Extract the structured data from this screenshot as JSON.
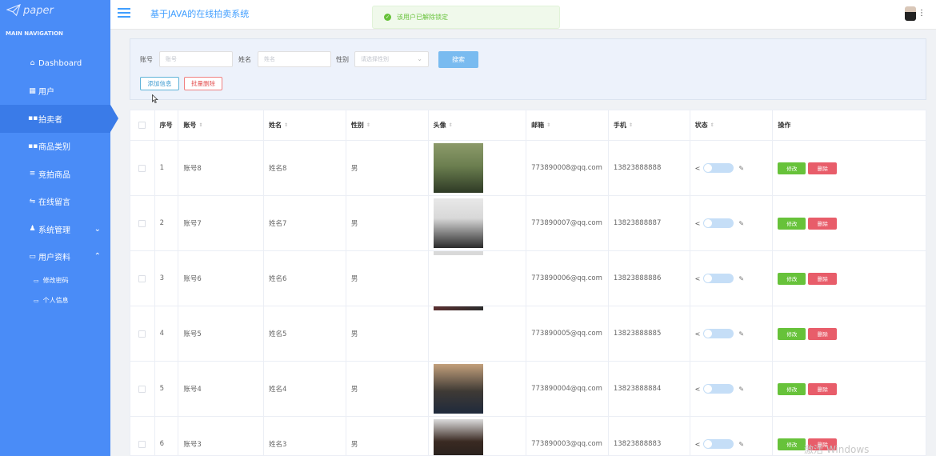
{
  "logo": {
    "text": "paper"
  },
  "sidebar": {
    "header": "MAIN NAVIGATION",
    "items": [
      {
        "label": "Dashboard",
        "icon": "home-icon",
        "glyph": "⌂"
      },
      {
        "label": "用户",
        "icon": "grid-icon",
        "glyph": "▦"
      },
      {
        "label": "拍卖者",
        "icon": "grid-icon",
        "glyph": "▪▪"
      },
      {
        "label": "商品类别",
        "icon": "grid-icon",
        "glyph": "▪▪"
      },
      {
        "label": "竞拍商品",
        "icon": "list-icon",
        "glyph": "≡"
      },
      {
        "label": "在线留言",
        "icon": "sliders-icon",
        "glyph": "⇋"
      },
      {
        "label": "系统管理",
        "icon": "user-icon",
        "glyph": "♟"
      },
      {
        "label": "用户资料",
        "icon": "card-icon",
        "glyph": "▭"
      }
    ],
    "subitems": [
      {
        "label": "修改密码",
        "icon": "folder-icon"
      },
      {
        "label": "个人信息",
        "icon": "folder-icon"
      }
    ]
  },
  "topbar": {
    "title": "基于JAVA的在线拍卖系统",
    "toast": "该用户已解除锁定"
  },
  "search": {
    "account_label": "账号",
    "account_placeholder": "账号",
    "name_label": "姓名",
    "name_placeholder": "姓名",
    "gender_label": "性别",
    "gender_placeholder": "请选择性别",
    "search_button": "搜索",
    "add_button": "添加信息",
    "batch_delete_button": "批量删除"
  },
  "table": {
    "headers": [
      "序号",
      "账号",
      "姓名",
      "性别",
      "头像",
      "邮箱",
      "手机",
      "状态",
      "操作"
    ],
    "edit_label": "修改",
    "delete_label": "删除",
    "rows": [
      {
        "no": "1",
        "account": "账号8",
        "name": "姓名8",
        "gender": "男",
        "email": "773890008@qq.com",
        "phone": "13823888888",
        "photo": "full"
      },
      {
        "no": "2",
        "account": "账号7",
        "name": "姓名7",
        "gender": "男",
        "email": "773890007@qq.com",
        "phone": "13823888887",
        "photo": "full"
      },
      {
        "no": "3",
        "account": "账号6",
        "name": "姓名6",
        "gender": "男",
        "email": "773890006@qq.com",
        "phone": "13823888886",
        "photo": "partial-top"
      },
      {
        "no": "4",
        "account": "账号5",
        "name": "姓名5",
        "gender": "男",
        "email": "773890005@qq.com",
        "phone": "13823888885",
        "photo": "partial-top"
      },
      {
        "no": "5",
        "account": "账号4",
        "name": "姓名4",
        "gender": "男",
        "email": "773890004@qq.com",
        "phone": "13823888884",
        "photo": "full"
      },
      {
        "no": "6",
        "account": "账号3",
        "name": "姓名3",
        "gender": "男",
        "email": "773890003@qq.com",
        "phone": "13823888883",
        "photo": "full"
      }
    ]
  },
  "watermark": "激活 Windows"
}
